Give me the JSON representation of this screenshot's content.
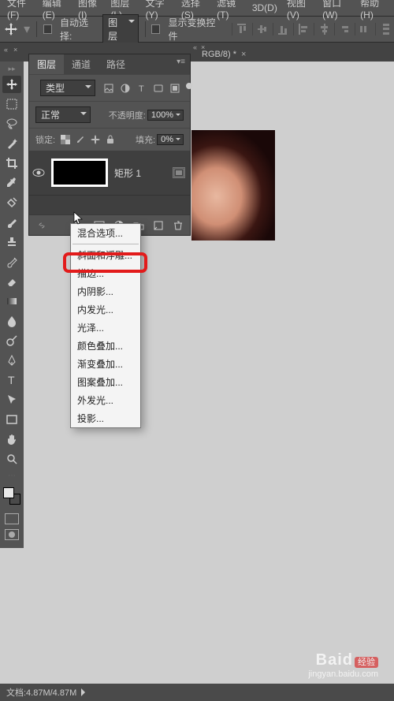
{
  "menu": {
    "items": [
      "文件(F)",
      "编辑(E)",
      "图像(I)",
      "图层(L)",
      "文字(Y)",
      "选择(S)",
      "滤镜(T)",
      "3D(D)",
      "视图(V)",
      "窗口(W)",
      "帮助(H)"
    ]
  },
  "options": {
    "auto_select": "自动选择:",
    "target_dd": "图层",
    "show_transform": "显示变换控件"
  },
  "doc_tab": {
    "label": "RGB/8) *"
  },
  "layers_panel": {
    "tabs": [
      "图层",
      "通道",
      "路径"
    ],
    "kind_label": "类型",
    "blend_mode": "正常",
    "opacity_label": "不透明度:",
    "opacity_value": "100%",
    "lock_label": "锁定:",
    "fill_label": "填充:",
    "fill_value": "0%",
    "layer": {
      "name": "矩形 1"
    }
  },
  "fx_menu": {
    "items": [
      "混合选项...",
      "斜面和浮雕...",
      "描边...",
      "内阴影...",
      "内发光...",
      "光泽...",
      "颜色叠加...",
      "渐变叠加...",
      "图案叠加...",
      "外发光...",
      "投影..."
    ]
  },
  "status": {
    "doc_size": "文档:4.87M/4.87M"
  },
  "watermark": {
    "brand": "Baid",
    "suffix": "经验",
    "url": "jingyan.baidu.com"
  }
}
